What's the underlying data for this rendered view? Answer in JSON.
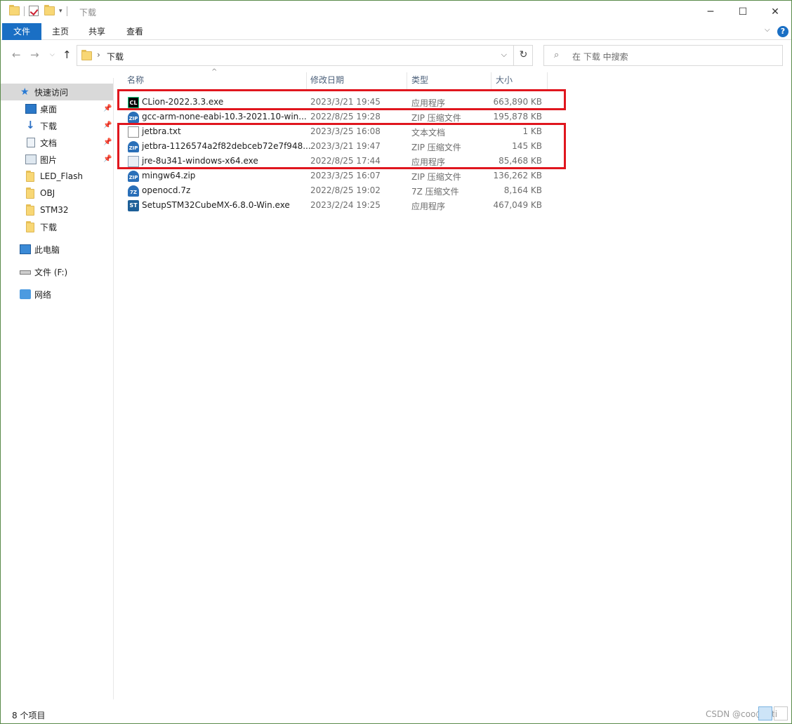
{
  "window": {
    "title": "下载"
  },
  "ribbon": {
    "tabs": [
      "文件",
      "主页",
      "共享",
      "查看"
    ]
  },
  "address": {
    "path": "下载"
  },
  "search": {
    "placeholder": "在 下载 中搜索"
  },
  "nav": {
    "items": [
      {
        "label": "快速访问",
        "icon": "star-icon"
      },
      {
        "label": "桌面",
        "icon": "desktop-icon",
        "pinned": true
      },
      {
        "label": "下载",
        "icon": "download-icon",
        "pinned": true
      },
      {
        "label": "文档",
        "icon": "document-icon",
        "pinned": true
      },
      {
        "label": "图片",
        "icon": "picture-icon",
        "pinned": true
      },
      {
        "label": "LED_Flash",
        "icon": "folder-icon"
      },
      {
        "label": "OBJ",
        "icon": "folder-icon"
      },
      {
        "label": "STM32",
        "icon": "folder-icon"
      },
      {
        "label": "下载",
        "icon": "folder-icon"
      },
      {
        "label": "此电脑",
        "icon": "computer-icon"
      },
      {
        "label": "文件 (F:)",
        "icon": "drive-icon"
      },
      {
        "label": "网络",
        "icon": "network-icon"
      }
    ]
  },
  "columns": {
    "name": "名称",
    "date": "修改日期",
    "type": "类型",
    "size": "大小"
  },
  "files": [
    {
      "name": "CLion-2022.3.3.exe",
      "date": "2023/3/21 19:45",
      "type": "应用程序",
      "size": "663,890 KB",
      "icon": "clion-icon"
    },
    {
      "name": "gcc-arm-none-eabi-10.3-2021.10-win...",
      "date": "2022/8/25 19:28",
      "type": "ZIP 压缩文件",
      "size": "195,878 KB",
      "icon": "zip-icon"
    },
    {
      "name": "jetbra.txt",
      "date": "2023/3/25 16:08",
      "type": "文本文档",
      "size": "1 KB",
      "icon": "text-file-icon"
    },
    {
      "name": "jetbra-1126574a2f82debceb72e7f948...",
      "date": "2023/3/21 19:47",
      "type": "ZIP 压缩文件",
      "size": "145 KB",
      "icon": "zip-icon"
    },
    {
      "name": "jre-8u341-windows-x64.exe",
      "date": "2022/8/25 17:44",
      "type": "应用程序",
      "size": "85,468 KB",
      "icon": "java-installer-icon"
    },
    {
      "name": "mingw64.zip",
      "date": "2023/3/25 16:07",
      "type": "ZIP 压缩文件",
      "size": "136,262 KB",
      "icon": "zip-icon"
    },
    {
      "name": "openocd.7z",
      "date": "2022/8/25 19:02",
      "type": "7Z 压缩文件",
      "size": "8,164 KB",
      "icon": "7z-icon"
    },
    {
      "name": "SetupSTM32CubeMX-6.8.0-Win.exe",
      "date": "2023/2/24 19:25",
      "type": "应用程序",
      "size": "467,049 KB",
      "icon": "stm32-icon"
    }
  ],
  "status": {
    "count": "8 个项目"
  },
  "watermark": "CSDN @coo@aiti",
  "colors": {
    "accent": "#1a6fc4",
    "highlight": "#e0161e"
  }
}
